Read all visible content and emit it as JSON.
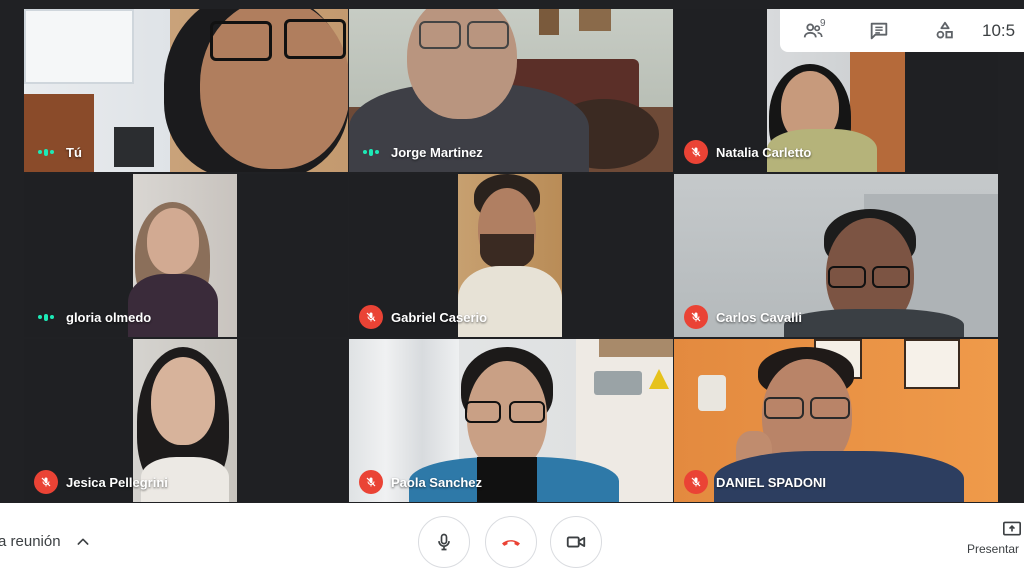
{
  "topbar": {
    "participants_count": "9",
    "clock": "10:5"
  },
  "tiles": [
    {
      "name": "Tú",
      "status": "speaking"
    },
    {
      "name": "Jorge Martinez",
      "status": "speaking"
    },
    {
      "name": "Natalia Carletto",
      "status": "muted"
    },
    {
      "name": "gloria olmedo",
      "status": "speaking"
    },
    {
      "name": "Gabriel Caserio",
      "status": "muted"
    },
    {
      "name": "Carlos Cavalli",
      "status": "muted"
    },
    {
      "name": "Jesica Pellegrini",
      "status": "muted"
    },
    {
      "name": "Paola Sanchez",
      "status": "muted"
    },
    {
      "name": "DANIEL SPADONI",
      "status": "muted"
    }
  ],
  "bottombar": {
    "details_label": "a reunión",
    "present_label": "Presentar"
  },
  "colors": {
    "muted_badge": "#ea4335",
    "speaking_indicator": "#1de9b6",
    "grid_background": "#202124"
  },
  "icons": [
    "people-icon",
    "chat-icon",
    "activities-icon",
    "chevron-up-icon",
    "mic-icon",
    "hangup-icon",
    "camera-icon",
    "present-icon",
    "mic-off-icon"
  ]
}
